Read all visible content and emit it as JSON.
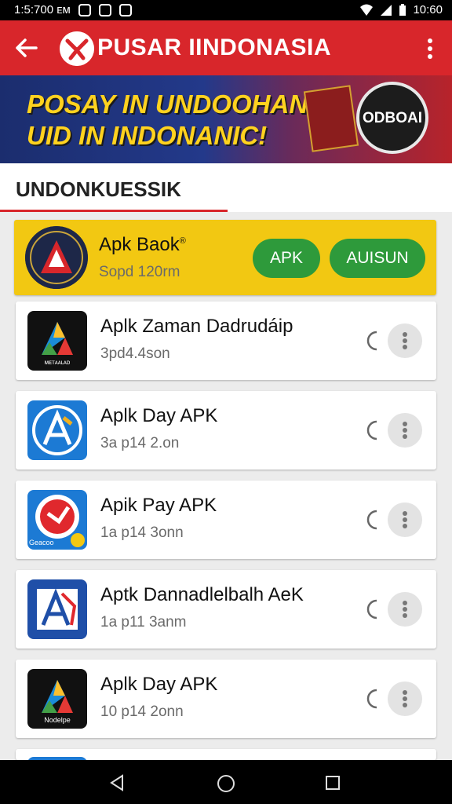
{
  "status_bar": {
    "time_left": "1:5:700 ᴇᴍ",
    "time_right": "10:60"
  },
  "app_bar": {
    "title": "PUSAR IINDONASIA",
    "color": "#d8262b"
  },
  "banner": {
    "line1": "POSAY IN UNDOOHAN",
    "line2": "UID IN INDONANIC!",
    "badge_text": "ODBOAI"
  },
  "section": {
    "title": "UNDONKUESSIK"
  },
  "featured": {
    "name": "Apk Baok",
    "reg_mark": "®",
    "size": "Sopd 120rm",
    "button_apk": "APK",
    "button_install": "AUISUN"
  },
  "apps": [
    {
      "name": "Aplk Zaman Dadrudáip",
      "size": "3pd4.4son",
      "icon_label": "ᴍᴇᴛᴀᴀʟᴀᴅ"
    },
    {
      "name": "Aplk Day APK",
      "size": "3a p14 2.on",
      "icon_label": ""
    },
    {
      "name": "Apik Pay APK",
      "size": "1a p14 3onn",
      "icon_label": "Geacoo"
    },
    {
      "name": "Aptk Dannadlelbalh AeK",
      "size": "1a p11 3anm",
      "icon_label": ""
    },
    {
      "name": "Aplk Day APK",
      "size": "10 p14 2onn",
      "icon_label": "Nodelpe"
    }
  ],
  "colors": {
    "accent": "#d8262b",
    "featured_bg": "#f2c812",
    "button_green": "#2e9a3b"
  }
}
